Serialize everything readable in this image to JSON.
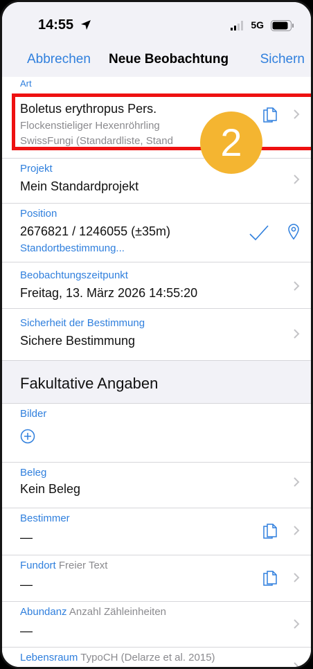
{
  "status_bar": {
    "time": "14:55",
    "network": "5G",
    "location_icon": "location-arrow-icon",
    "signal_icon": "signal-bars-icon",
    "battery_icon": "battery-icon"
  },
  "nav": {
    "cancel_label": "Abbrechen",
    "title": "Neue Beobachtung",
    "save_label": "Sichern"
  },
  "art": {
    "label": "Art",
    "value": "Boletus erythropus Pers.",
    "common_name": "Flockenstieliger Hexenröhrling",
    "list": "SwissFungi (Standardliste, Stand"
  },
  "projekt": {
    "label": "Projekt",
    "value": "Mein Standardprojekt"
  },
  "position": {
    "label": "Position",
    "value": "2676821 / 1246055 (±35m)",
    "action": "Standortbestimmung..."
  },
  "zeitpunkt": {
    "label": "Beobachtungszeitpunkt",
    "value": "Freitag, 13. März 2026 14:55:20"
  },
  "sicherheit": {
    "label": "Sicherheit der Bestimmung",
    "value": "Sichere Bestimmung"
  },
  "section": {
    "title": "Fakultative Angaben"
  },
  "bilder": {
    "label": "Bilder"
  },
  "beleg": {
    "label": "Beleg",
    "value": "Kein Beleg"
  },
  "bestimmer": {
    "label": "Bestimmer",
    "value": "—"
  },
  "fundort": {
    "label": "Fundort",
    "sub": "Freier Text",
    "value": "—"
  },
  "abundanz": {
    "label": "Abundanz",
    "sub": "Anzahl Zähleinheiten",
    "value": "—"
  },
  "lebensraum": {
    "label": "Lebensraum",
    "sub": "TypoCH (Delarze et al. 2015)"
  },
  "annotation": {
    "step_number": "2",
    "highlight_color": "#ee1111",
    "badge_color": "#f4b531"
  },
  "colors": {
    "accent": "#2f7fdd",
    "secondary_text": "#8a8a8e",
    "background_gray": "#f2f2f7"
  }
}
